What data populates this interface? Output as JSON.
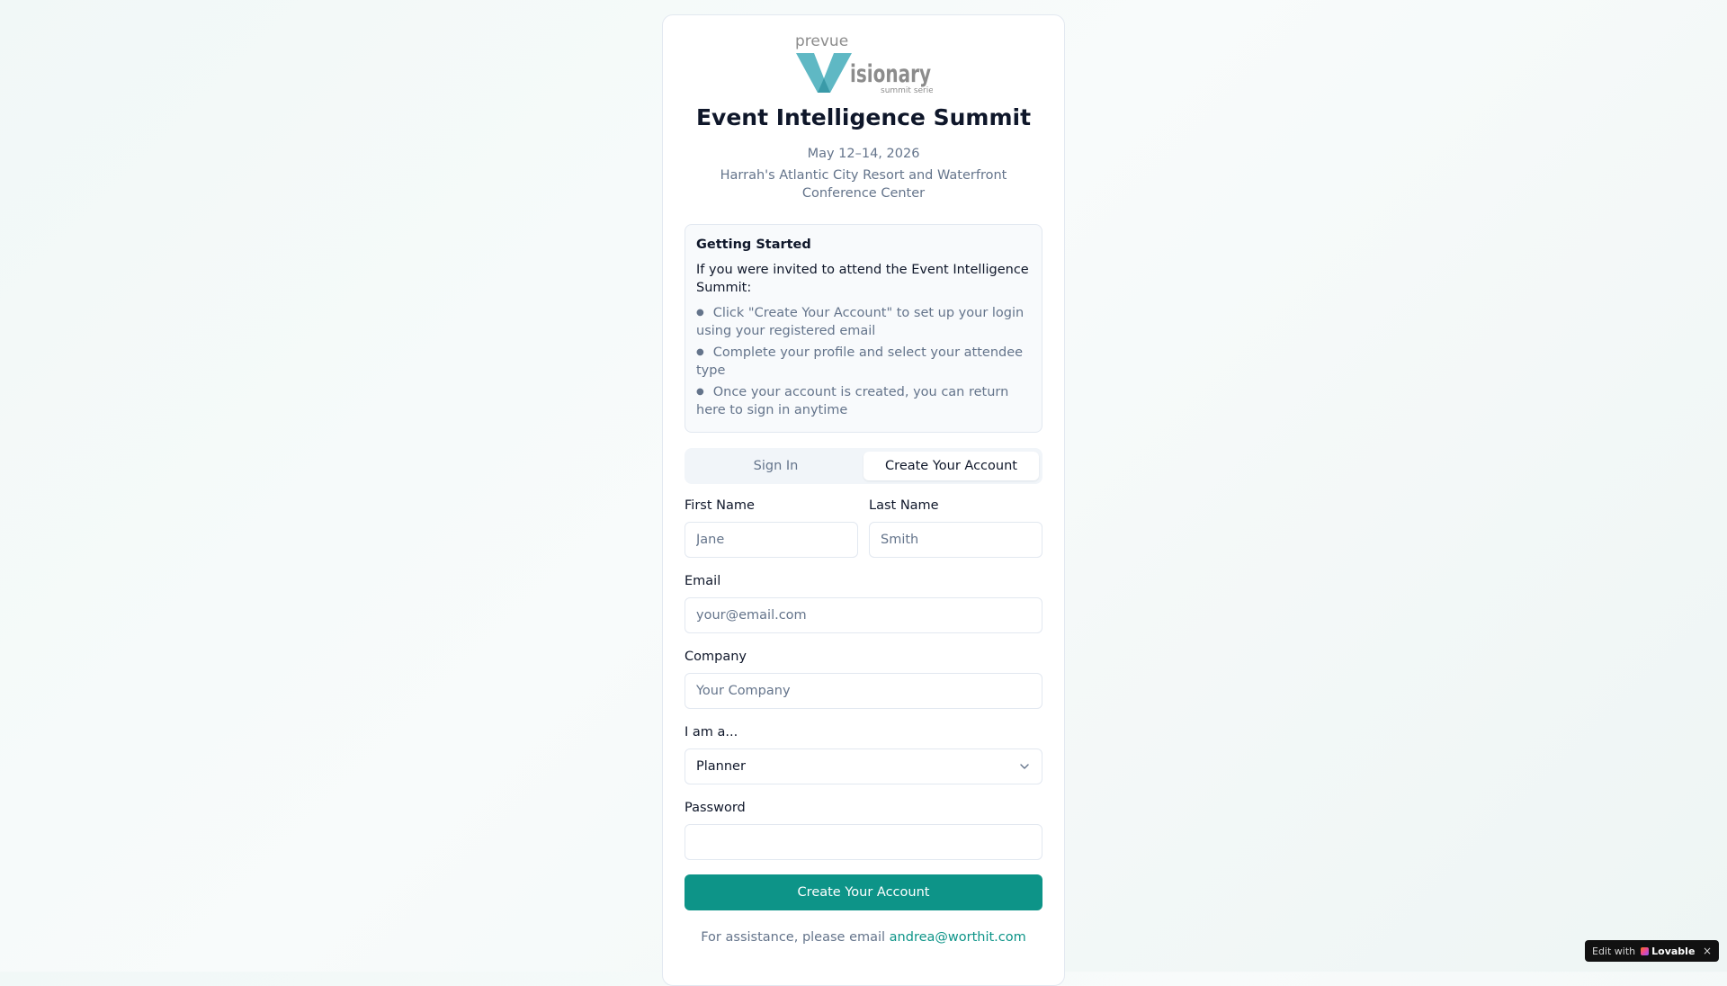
{
  "logo": {
    "top_text": "prevue",
    "main_text": "isionary",
    "sub_text": "summit series",
    "colors": {
      "teal": "#5fb8c4",
      "gray": "#8c8c8c"
    }
  },
  "event": {
    "title": "Event Intelligence Summit",
    "dates": "May 12–14, 2026",
    "venue": "Harrah's Atlantic City Resort and Waterfront Conference Center"
  },
  "getting_started": {
    "title": "Getting Started",
    "intro": "If you were invited to attend the Event Intelligence Summit:",
    "steps": [
      "Click \"Create Your Account\" to set up your login using your registered email",
      "Complete your profile and select your attendee type",
      "Once your account is created, you can return here to sign in anytime"
    ]
  },
  "tabs": [
    {
      "label": "Sign In",
      "active": false
    },
    {
      "label": "Create Your Account",
      "active": true
    }
  ],
  "form": {
    "first_name": {
      "label": "First Name",
      "placeholder": "Jane",
      "value": ""
    },
    "last_name": {
      "label": "Last Name",
      "placeholder": "Smith",
      "value": ""
    },
    "email": {
      "label": "Email",
      "placeholder": "your@email.com",
      "value": ""
    },
    "company": {
      "label": "Company",
      "placeholder": "Your Company",
      "value": ""
    },
    "role": {
      "label": "I am a...",
      "selected": "Planner",
      "icon": "chevron-down-icon"
    },
    "password": {
      "label": "Password",
      "placeholder": "",
      "value": ""
    },
    "submit_label": "Create Your Account"
  },
  "assistance": {
    "text": "For assistance, please email",
    "email": "andrea@worthit.com"
  },
  "badge": {
    "prefix": "Edit with",
    "brand": "Lovable",
    "close": "×"
  },
  "colors": {
    "accent": "#0d9488",
    "muted_text": "#64748b",
    "border": "#e2e8f0"
  }
}
